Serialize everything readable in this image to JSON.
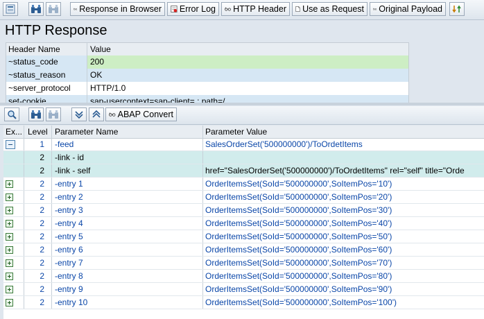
{
  "toolbar": {
    "buttons": [
      {
        "label": "Response in Browser"
      },
      {
        "label": "Error Log"
      },
      {
        "label": "HTTP Header"
      },
      {
        "label": "Use as Request"
      },
      {
        "label": "Original Payload"
      }
    ]
  },
  "title": "HTTP Response",
  "header_table": {
    "columns": [
      "Header Name",
      "Value"
    ],
    "rows": [
      {
        "name": "~status_code",
        "value": "200"
      },
      {
        "name": "~status_reason",
        "value": "OK"
      },
      {
        "name": "~server_protocol",
        "value": "HTTP/1.0"
      },
      {
        "name": "set-cookie",
        "value": "sap-usercontext=sap-client=     ; path=/"
      }
    ]
  },
  "toolbar2": {
    "abap_convert": "ABAP Convert"
  },
  "param_table": {
    "columns": [
      "Ex...",
      "Level",
      "Parameter Name",
      "Parameter Value"
    ],
    "rows": [
      {
        "level": "1",
        "name": "-feed",
        "value": "SalesOrderSet('500000000')/ToOrdetItems"
      },
      {
        "level": "2",
        "name": "-link - id",
        "value": ""
      },
      {
        "level": "2",
        "name": "-link - self",
        "value": "href=\"SalesOrderSet('500000000')/ToOrdetItems\" rel=\"self\" title=\"Orde"
      },
      {
        "level": "2",
        "name": "-entry 1",
        "value": "OrderItemsSet(SoId='500000000',SoItemPos='10')"
      },
      {
        "level": "2",
        "name": "-entry 2",
        "value": "OrderItemsSet(SoId='500000000',SoItemPos='20')"
      },
      {
        "level": "2",
        "name": "-entry 3",
        "value": "OrderItemsSet(SoId='500000000',SoItemPos='30')"
      },
      {
        "level": "2",
        "name": "-entry 4",
        "value": "OrderItemsSet(SoId='500000000',SoItemPos='40')"
      },
      {
        "level": "2",
        "name": "-entry 5",
        "value": "OrderItemsSet(SoId='500000000',SoItemPos='50')"
      },
      {
        "level": "2",
        "name": "-entry 6",
        "value": "OrderItemsSet(SoId='500000000',SoItemPos='60')"
      },
      {
        "level": "2",
        "name": "-entry 7",
        "value": "OrderItemsSet(SoId='500000000',SoItemPos='70')"
      },
      {
        "level": "2",
        "name": "-entry 8",
        "value": "OrderItemsSet(SoId='500000000',SoItemPos='80')"
      },
      {
        "level": "2",
        "name": "-entry 9",
        "value": "OrderItemsSet(SoId='500000000',SoItemPos='90')"
      },
      {
        "level": "2",
        "name": "-entry 10",
        "value": "OrderItemsSet(SoId='500000000',SoItemPos='100')"
      }
    ]
  },
  "colors": {
    "status_code_bg": "#cdeec4",
    "highlight_row": "#d1ecec",
    "link_blue": "#0a46a8"
  }
}
